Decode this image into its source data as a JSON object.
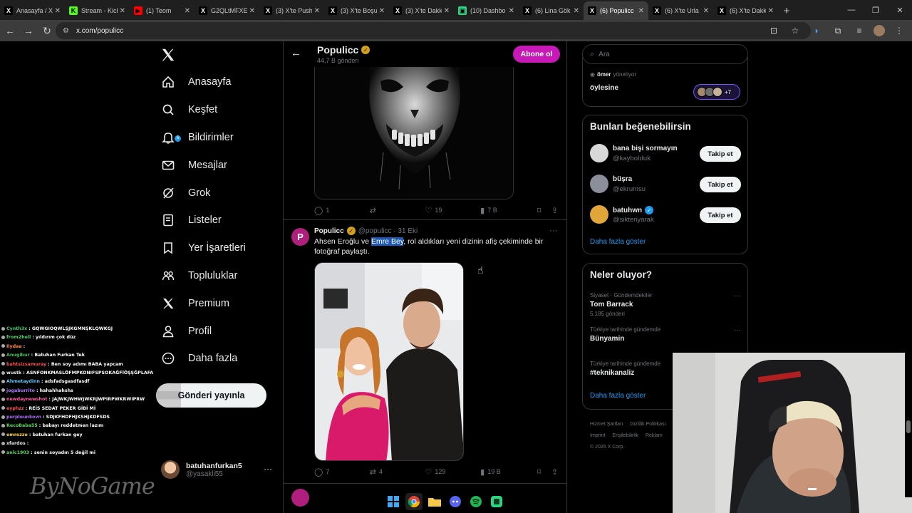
{
  "browser": {
    "tabs": [
      {
        "title": "Anasayfa / X",
        "favicon": "x-icon",
        "fav_text": "X",
        "fav_color": "#000000"
      },
      {
        "title": "Stream - Kick",
        "favicon": "kick-icon",
        "fav_text": "K",
        "fav_color": "#53fc18"
      },
      {
        "title": "(1) Teom",
        "favicon": "youtube-icon",
        "fav_text": "▶",
        "fav_color": "#ff0000"
      },
      {
        "title": "G2QLtMFXE",
        "favicon": "x-icon",
        "fav_text": "X",
        "fav_color": "#000000"
      },
      {
        "title": "(3) X'te Push",
        "favicon": "x-icon",
        "fav_text": "X",
        "fav_color": "#000000"
      },
      {
        "title": "(3) X'te Boşu",
        "favicon": "x-icon",
        "fav_text": "X",
        "fav_color": "#000000"
      },
      {
        "title": "(3) X'te Dakk",
        "favicon": "x-icon",
        "fav_text": "X",
        "fav_color": "#000000"
      },
      {
        "title": "(10) Dashbo",
        "favicon": "dashboard-icon",
        "fav_text": "▣",
        "fav_color": "#2bd680"
      },
      {
        "title": "(6) Lina Gök",
        "favicon": "x-icon",
        "fav_text": "X",
        "fav_color": "#000000"
      },
      {
        "title": "(6) Populicc",
        "favicon": "x-icon",
        "fav_text": "X",
        "fav_color": "#000000",
        "active": true
      },
      {
        "title": "(6) X'te Urla",
        "favicon": "x-icon",
        "fav_text": "X",
        "fav_color": "#000000"
      },
      {
        "title": "(6) X'te Dakk",
        "favicon": "x-icon",
        "fav_text": "X",
        "fav_color": "#000000"
      }
    ],
    "new_tab": "+",
    "url": "x.com/populicc"
  },
  "sidebar": {
    "logo": "X",
    "items": [
      {
        "label": "Anasayfa",
        "icon": "home-icon"
      },
      {
        "label": "Keşfet",
        "icon": "search-icon"
      },
      {
        "label": "Bildirimler",
        "icon": "bell-icon",
        "badge": "6"
      },
      {
        "label": "Mesajlar",
        "icon": "mail-icon"
      },
      {
        "label": "Grok",
        "icon": "grok-icon"
      },
      {
        "label": "Listeler",
        "icon": "list-icon"
      },
      {
        "label": "Yer İşaretleri",
        "icon": "bookmark-icon"
      },
      {
        "label": "Topluluklar",
        "icon": "communities-icon"
      },
      {
        "label": "Premium",
        "icon": "x-premium-icon"
      },
      {
        "label": "Profil",
        "icon": "profile-icon"
      },
      {
        "label": "Daha fazla",
        "icon": "more-circle-icon"
      }
    ],
    "post_button": "Gönderi yayınla",
    "account": {
      "name": "batuhanfurkan5",
      "handle": "@yasakli55",
      "more": "···"
    }
  },
  "chat": {
    "lines": [
      {
        "user": "Cynth3x",
        "color": "#3ecf6a",
        "msg": "GQWGIOQWLŞJKGMNŞKLQWKGJ"
      },
      {
        "user": "from2hell",
        "color": "#4fd66b",
        "msg": "yıldırım çok düz"
      },
      {
        "user": "Ilydaa",
        "color": "#ff8a3d",
        "msg": ""
      },
      {
        "user": "Anugibur",
        "color": "#45c15e",
        "msg": "Batuhan Furkan Tek"
      },
      {
        "user": "bahtsizsamuray",
        "color": "#ff4f4f",
        "msg": "Ben soy adımı BABA yapcam"
      },
      {
        "user": "wustk",
        "color": "#eaeaea",
        "msg": "ASNFONKMASLÖFMPKONIFSPSOKAĞFİÖŞŞĞPLAFA"
      },
      {
        "user": "Ahmetaydinn",
        "color": "#5cc8ff",
        "msg": "adsfadsgasdfasdf"
      },
      {
        "user": "jogaburrito",
        "color": "#b07cff",
        "msg": "hahahhahshs"
      },
      {
        "user": "newdaynewshot",
        "color": "#ff5ea8",
        "msg": "JAJWKJWHWJWKRJWPIRPWKRWIPRW"
      },
      {
        "user": "eyphzz",
        "color": "#ff5252",
        "msg": "REİS SEDAT PEKER GİBİ Mİ"
      },
      {
        "user": "purpleunkovn",
        "color": "#b26bff",
        "msg": "SDJKFHDFHJKSHJKDFSDS"
      },
      {
        "user": "RecoBaba55",
        "color": "#57d85b",
        "msg": "babayı reddetmen lazım"
      },
      {
        "user": "emrezzo",
        "color": "#ffd23f",
        "msg": "batuhan furkan gey"
      },
      {
        "user": "xfardos",
        "color": "#eaeaea",
        "msg": ""
      },
      {
        "user": "anlc1903",
        "color": "#57d85b",
        "msg": "senin soyadın 5 değil mi"
      }
    ],
    "stream_logo": "ByNoGame"
  },
  "profile": {
    "name": "Populicc",
    "post_count": "44,7 B gönderi",
    "subscribe_label": "Abone ol"
  },
  "tweet1": {
    "replies": "1",
    "reposts": "",
    "likes": "19",
    "views": "7 B"
  },
  "tweet2": {
    "avatar_letter": "P",
    "name": "Populicc",
    "handle_time": "@populicc · 31 Eki",
    "text_before": "Ahsen Eroğlu ve ",
    "text_highlight": "Emre Bey",
    "text_after": ", rol aldıkları yeni dizinin afiş çekiminde bir fotoğraf paylaştı.",
    "replies": "7",
    "reposts": "4",
    "likes": "129",
    "views": "19 B"
  },
  "right": {
    "search_placeholder": "Ara",
    "spaces": {
      "host": "ömer",
      "host_suffix": "yönetiyor",
      "title": "öylesine",
      "extra": "+7"
    },
    "wtf_title": "Bunları beğenebilirsin",
    "suggestions": [
      {
        "name": "bana bişi sormayın",
        "handle": "@kayboIduk",
        "follow": "Takip et",
        "verified": false,
        "avatar_color": "#d8d8d8"
      },
      {
        "name": "büşra",
        "handle": "@ekrumsu",
        "follow": "Takip et",
        "verified": false,
        "avatar_color": "#8a8f99"
      },
      {
        "name": "batuhwn",
        "handle": "@siktenyarak",
        "follow": "Takip et",
        "verified": true,
        "avatar_color": "#e0a63a"
      }
    ],
    "show_more": "Daha fazla göster",
    "trends_title": "Neler oluyor?",
    "trends": [
      {
        "context": "Siyaset · Gündemdekiler",
        "name": "Tom Barrack",
        "posts": "5.185 gönderi"
      },
      {
        "context": "Türkiye tarihinde gündemde",
        "name": "Bünyamin",
        "posts": ""
      },
      {
        "context": "Türkiye tarihinde gündemde",
        "name": "#teknikanaliz",
        "posts": ""
      }
    ],
    "trends_more": "Daha fazla göster",
    "footer": [
      "Hizmet Şartları",
      "Gizlilik Politikası",
      "Imprint",
      "Erişilebilirlik",
      "Reklam",
      "© 2025 X Corp."
    ]
  },
  "taskbar": {
    "items": [
      "windows-start-icon",
      "chrome-icon",
      "file-explorer-icon",
      "discord-icon",
      "spotify-icon",
      "dashboard-app-icon"
    ]
  }
}
